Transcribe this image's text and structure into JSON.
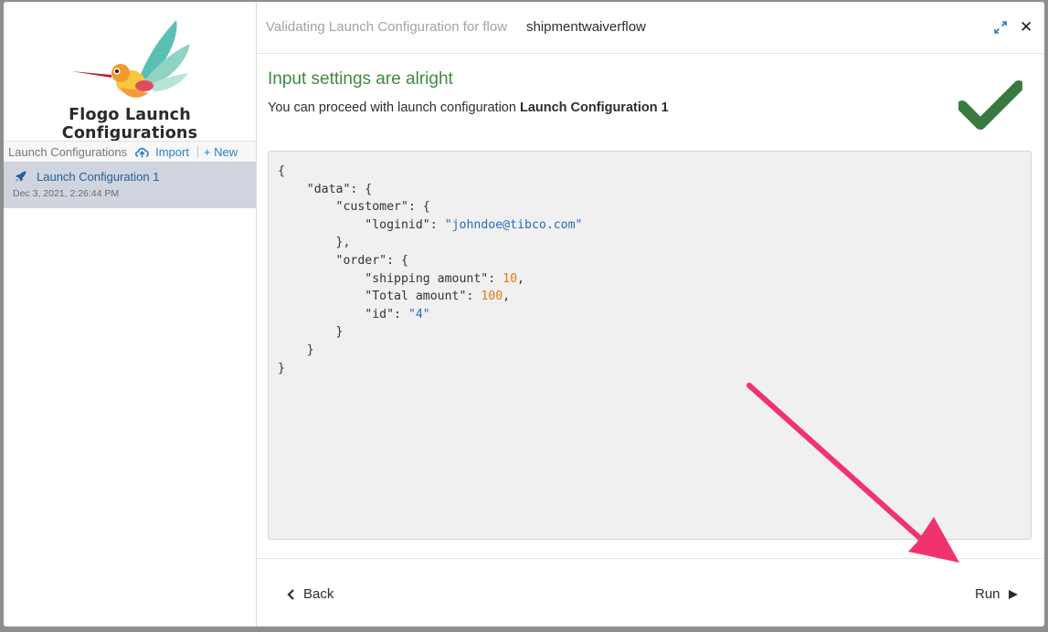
{
  "sidebar": {
    "brand": "Flogo Launch Configurations",
    "toolbar": {
      "title": "Launch Configurations",
      "import_label": "Import",
      "new_label": "+ New"
    },
    "items": [
      {
        "name": "Launch Configuration 1",
        "date": "Dec 3, 2021, 2:26:44 PM",
        "icon": "rocket-icon"
      }
    ]
  },
  "header": {
    "prefix": "Validating Launch Configuration for flow",
    "flow_name": "shipmentwaiverflow"
  },
  "status": {
    "title": "Input settings are alright",
    "subtitle_prefix": "You can proceed with launch configuration",
    "subtitle_config": "Launch Configuration 1",
    "icon": "checkmark-icon"
  },
  "json_lines": {
    "l1": "{",
    "l2": "    \"data\": {",
    "l3": "        \"customer\": {",
    "l4_key": "            \"loginid\": ",
    "l4_val": "\"johndoe@tibco.com\"",
    "l5": "        },",
    "l6": "        \"order\": {",
    "l7_key": "            \"shipping amount\": ",
    "l7_val": "10",
    "l8_key": "            \"Total amount\": ",
    "l8_val": "100",
    "l9_key": "            \"id\": ",
    "l9_val": "\"4\"",
    "l10": "        }",
    "l11": "    }",
    "l12": "}",
    "comma": ","
  },
  "footer": {
    "back_label": "Back",
    "run_label": "Run"
  },
  "colors": {
    "success": "#3f8a3f",
    "link": "#2a7fc7",
    "annotation_arrow": "#f0336f"
  }
}
